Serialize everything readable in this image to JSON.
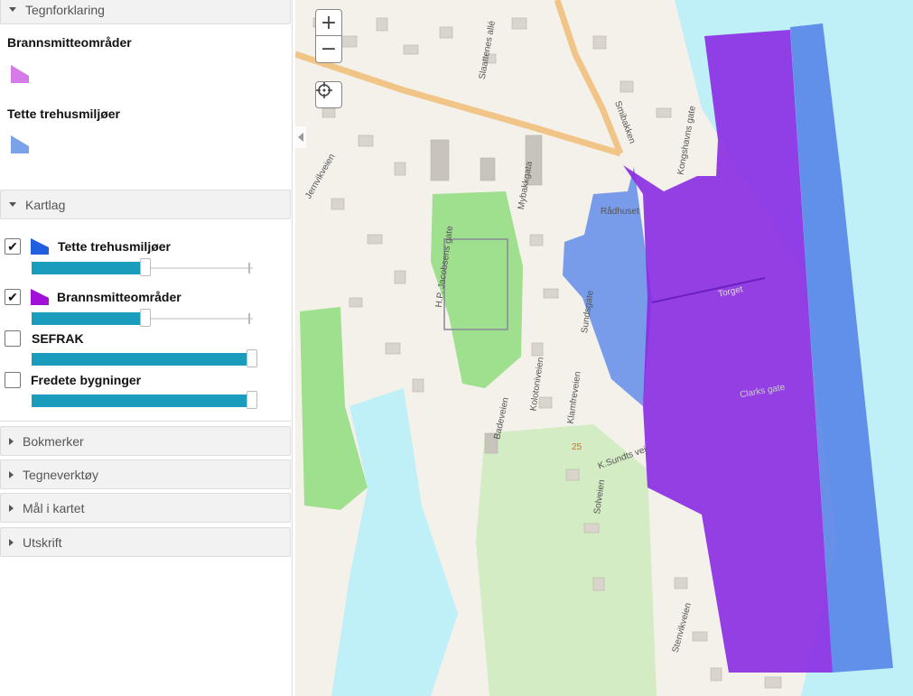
{
  "legend": {
    "header": "Tegnforklaring",
    "items": [
      {
        "label": "Brannsmitteområder",
        "color": "#d57ae6"
      },
      {
        "label": "Tette trehusmiljøer",
        "color": "#7aa2e8"
      }
    ]
  },
  "layers": {
    "header": "Kartlag",
    "items": [
      {
        "label": "Tette trehusmiljøer",
        "checked": true,
        "icon_color": "#1f5fe0",
        "opacity": 0.5
      },
      {
        "label": "Brannsmitteområder",
        "checked": true,
        "icon_color": "#a010d8",
        "opacity": 0.5
      },
      {
        "label": "SEFRAK",
        "checked": false,
        "opacity": 1.0
      },
      {
        "label": "Fredete bygninger",
        "checked": false,
        "opacity": 1.0
      }
    ]
  },
  "panels": [
    {
      "label": "Bokmerker"
    },
    {
      "label": "Tegneverktøy"
    },
    {
      "label": "Mål i kartet"
    },
    {
      "label": "Utskrift"
    }
  ],
  "map": {
    "zoom_in": "+",
    "zoom_out": "−",
    "labels": {
      "radhuset": "Rådhuset",
      "torget": "Torget",
      "kongshavns": "Kongshavns gate",
      "mybakkgata": "Mybakkgata",
      "jacobsens": "H.P. Jacobsens gate",
      "badeveien": "Badeveien",
      "kolotoniveien": "Kolotoniveien",
      "klamfreveien": "Klamfreveien",
      "solveien": "Solveien",
      "sundsvei": "K.Sundts vei",
      "stenvikveien": "Stenvikveien",
      "clarks": "Clarks gate",
      "slaattenes": "Slaattenes allé",
      "smibakken": "Smibakken",
      "jernvikveien": "Jernvikveien",
      "sundsgate": "Sundsgate",
      "contour_25": "25"
    },
    "colors": {
      "sea": "#bfeff7",
      "park": "#9ee08e",
      "forest": "#d3ecc3",
      "brannsmitte": "#8a2be2",
      "trehus": "#4f7fe8",
      "road": "#f1c487"
    }
  }
}
